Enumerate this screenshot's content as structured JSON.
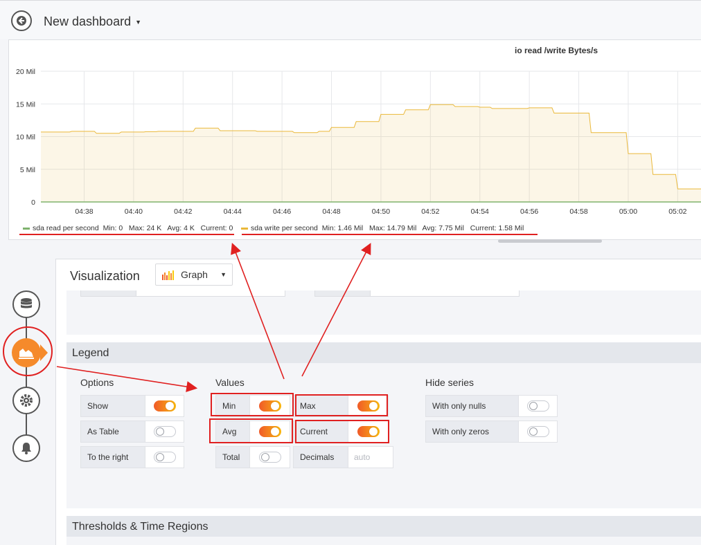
{
  "header": {
    "title": "New dashboard"
  },
  "panel": {
    "title": "io read /write Bytes/s",
    "legend": [
      {
        "name": "sda read per second",
        "color": "#7eb26d",
        "stats": "Min: 0   Max: 24 K   Avg: 4 K   Current: 0"
      },
      {
        "name": "sda write per second",
        "color": "#eab839",
        "stats": "Min: 1.46 Mil   Max: 14.79 Mil   Avg: 7.75 Mil   Current: 1.58 Mil"
      }
    ]
  },
  "chart_data": {
    "type": "area",
    "title": "io read /write Bytes/s",
    "xlabel": "",
    "ylabel": "",
    "y_ticks": [
      "0",
      "5 Mil",
      "10 Mil",
      "15 Mil",
      "20 Mil"
    ],
    "ylim": [
      0,
      20000000
    ],
    "x_ticks": [
      "04:38",
      "04:40",
      "04:42",
      "04:44",
      "04:46",
      "04:48",
      "04:50",
      "04:52",
      "04:54",
      "04:56",
      "04:58",
      "05:00",
      "05:02"
    ],
    "grid": true,
    "legend_position": "bottom",
    "series": [
      {
        "name": "sda read per second",
        "color": "#7eb26d",
        "x": [
          "04:36:15",
          "05:03:00"
        ],
        "y": [
          0,
          0
        ]
      },
      {
        "name": "sda write per second",
        "color": "#eab839",
        "x": [
          "04:36:15",
          "04:37:00",
          "04:37:30",
          "04:38:00",
          "04:38:30",
          "04:39:00",
          "04:39:30",
          "04:40:00",
          "04:40:30",
          "04:41:00",
          "04:41:30",
          "04:42:00",
          "04:42:30",
          "04:43:00",
          "04:43:30",
          "04:44:00",
          "04:44:30",
          "04:45:00",
          "04:45:30",
          "04:46:00",
          "04:46:30",
          "04:47:00",
          "04:47:30",
          "04:48:00",
          "04:48:30",
          "04:49:00",
          "04:49:30",
          "04:50:00",
          "04:50:30",
          "04:51:00",
          "04:51:30",
          "04:52:00",
          "04:52:30",
          "04:53:00",
          "04:53:30",
          "04:54:00",
          "04:54:30",
          "04:55:00",
          "04:55:30",
          "04:56:00",
          "04:56:30",
          "04:57:00",
          "04:57:30",
          "04:58:00",
          "04:58:30",
          "04:59:00",
          "04:59:30",
          "05:00:00",
          "05:00:30",
          "05:01:00",
          "05:01:30",
          "05:02:00",
          "05:02:30",
          "05:03:00"
        ],
        "y": [
          10.7,
          10.7,
          10.8,
          10.8,
          10.5,
          10.5,
          10.7,
          10.7,
          10.75,
          10.8,
          10.8,
          10.8,
          11.3,
          11.3,
          10.9,
          10.9,
          10.9,
          10.8,
          10.8,
          10.8,
          10.6,
          10.6,
          10.8,
          11.4,
          11.4,
          12.3,
          12.3,
          13.4,
          13.4,
          14.1,
          14.1,
          14.9,
          14.9,
          14.6,
          14.6,
          14.5,
          14.3,
          14.3,
          14.3,
          14.4,
          14.4,
          13.6,
          13.6,
          13.6,
          10.6,
          10.6,
          10.6,
          7.4,
          7.4,
          4.2,
          4.2,
          2.0,
          2.0,
          2.0
        ],
        "y_unit": "Mil"
      }
    ]
  },
  "editor": {
    "viz_label": "Visualization",
    "viz_value": "Graph",
    "legend_section": "Legend",
    "options_title": "Options",
    "values_title": "Values",
    "hide_title": "Hide series",
    "options": [
      {
        "label": "Show",
        "on": true
      },
      {
        "label": "As Table",
        "on": false
      },
      {
        "label": "To the right",
        "on": false
      }
    ],
    "values": {
      "min": {
        "label": "Min",
        "on": true
      },
      "max": {
        "label": "Max",
        "on": true
      },
      "avg": {
        "label": "Avg",
        "on": true
      },
      "current": {
        "label": "Current",
        "on": true
      },
      "total": {
        "label": "Total",
        "on": false
      },
      "decimals": {
        "label": "Decimals",
        "placeholder": "auto"
      }
    },
    "hide_series": [
      {
        "label": "With only nulls",
        "on": false
      },
      {
        "label": "With only zeros",
        "on": false
      }
    ],
    "thresholds_section": "Thresholds & Time Regions"
  },
  "colors": {
    "accent": "#f58a2b",
    "annotation": "#e02020"
  }
}
